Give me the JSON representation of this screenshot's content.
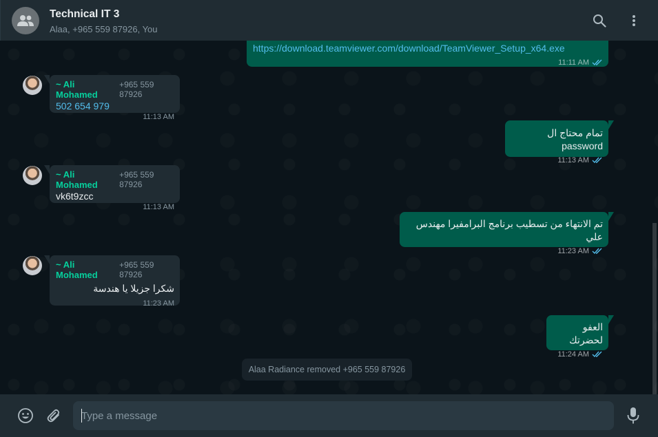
{
  "header": {
    "title": "Technical IT 3",
    "members": "Alaa, +965 559 87926, You"
  },
  "messages": [
    {
      "direction": "out",
      "text": "https://download.teamviewer.com/download/TeamViewer_Setup_x64.exe",
      "time": "11:11 AM",
      "status": "read"
    },
    {
      "direction": "in",
      "sender": "~ Ali Mohamed",
      "phone": "+965 559 87926",
      "text": "502 654 979",
      "time": "11:13 AM"
    },
    {
      "direction": "out",
      "text": "تمام محتاج ال password",
      "time": "11:13 AM",
      "status": "read"
    },
    {
      "direction": "in",
      "sender": "~ Ali Mohamed",
      "phone": "+965 559 87926",
      "text": "vk6t9zcc",
      "time": "11:13 AM"
    },
    {
      "direction": "out",
      "text": "تم الانتهاء من تسطيب برنامج البرامفيرا مهندس علي",
      "time": "11:23 AM",
      "status": "read"
    },
    {
      "direction": "in",
      "sender": "~ Ali Mohamed",
      "phone": "+965 559 87926",
      "text": "شكرا جزيلا يا هندسة",
      "time": "11:23 AM"
    },
    {
      "direction": "out",
      "text": "العفو لحضرتك",
      "time": "11:24 AM",
      "status": "read"
    }
  ],
  "system_message": "Alaa Radiance removed +965 559 87926",
  "composer": {
    "placeholder": "Type a message"
  },
  "icons": [
    "group-avatar-icon",
    "search-icon",
    "menu-icon",
    "emoji-icon",
    "attach-icon",
    "mic-icon",
    "read-ticks-icon"
  ],
  "colors": {
    "header_bg": "#202c33",
    "chat_bg": "#0b141a",
    "bubble_out": "#005c4b",
    "bubble_in": "#202c33",
    "sender_name": "#06cf9c",
    "link": "#53bdeb",
    "read_ticks": "#53bdeb"
  }
}
